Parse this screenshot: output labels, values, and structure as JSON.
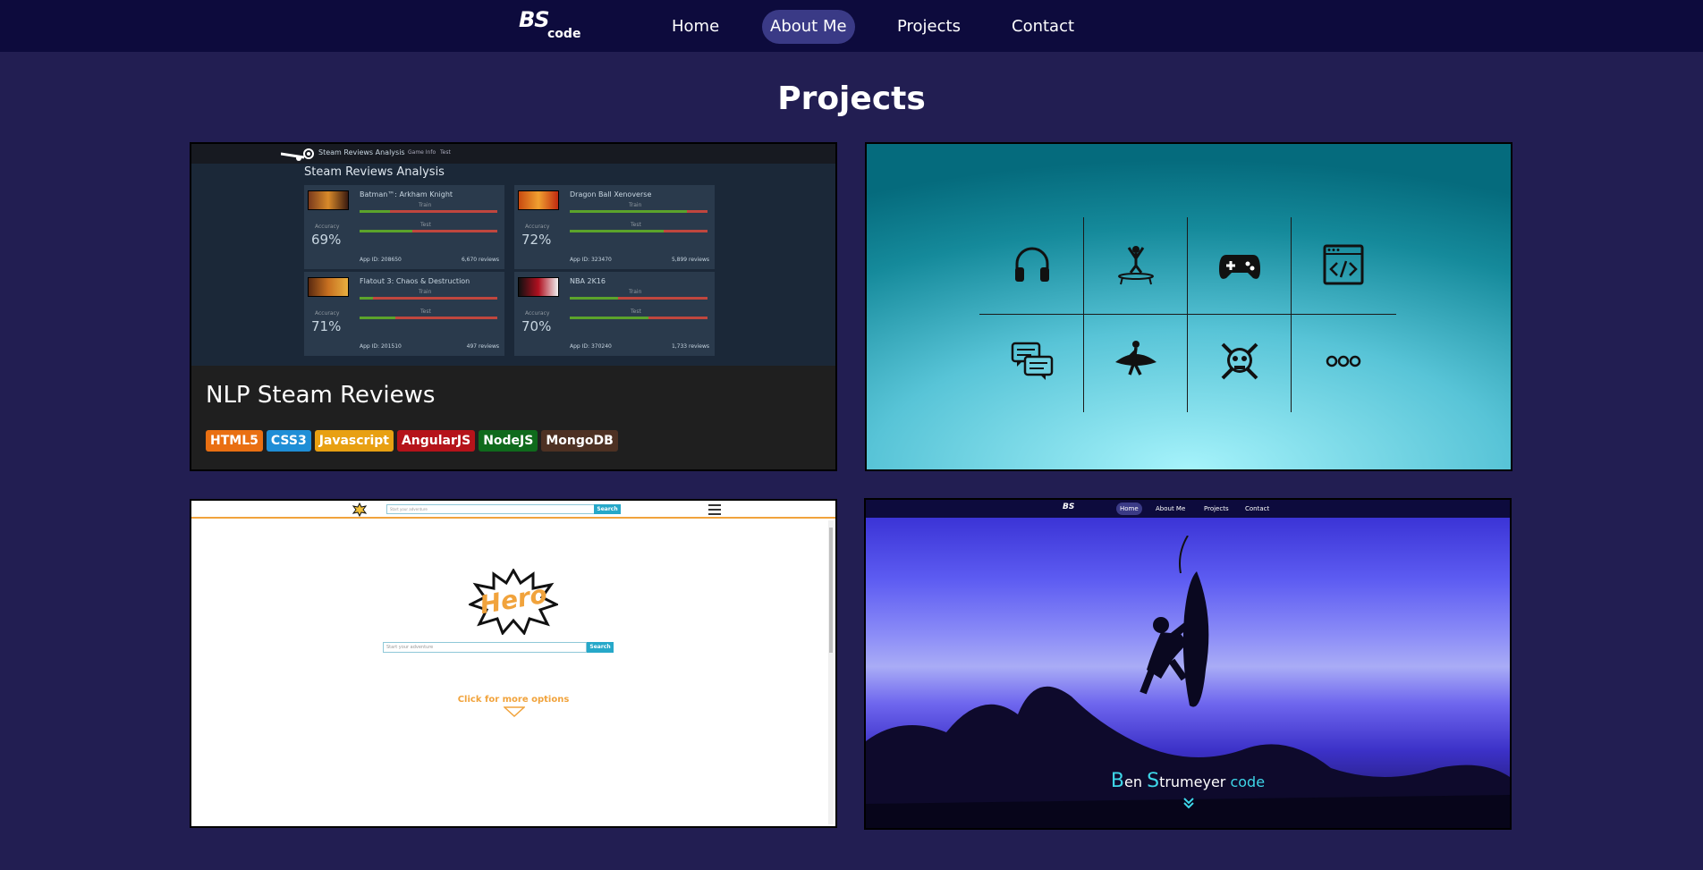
{
  "nav": {
    "logo_top": "BS",
    "logo_bottom": "code",
    "links": [
      {
        "label": "Home"
      },
      {
        "label": "About Me"
      },
      {
        "label": "Projects"
      },
      {
        "label": "Contact"
      }
    ],
    "active_link": "About Me"
  },
  "section": {
    "title": "Projects"
  },
  "colors": {
    "page_background": "#221e52",
    "navbar": "#0d0b3d",
    "nav_active": "#3a3a86"
  },
  "projects": [
    {
      "name": "NLP Steam Reviews",
      "badges": [
        {
          "label": "HTML5",
          "color": "#e96f12"
        },
        {
          "label": "CSS3",
          "color": "#1f8ed6"
        },
        {
          "label": "Javascript",
          "color": "#e8a012"
        },
        {
          "label": "AngularJS",
          "color": "#b5131a"
        },
        {
          "label": "NodeJS",
          "color": "#0f6a1c"
        },
        {
          "label": "MongoDB",
          "color": "#4d3123"
        }
      ],
      "preview": {
        "app_title": "Steam Reviews Analysis",
        "tabs": [
          "Game Info",
          "Test"
        ],
        "heading": "Steam Reviews Analysis",
        "games": [
          {
            "name": "Batman™: Arkham Knight",
            "accuracy": "69%",
            "app_id": "App ID: 208650",
            "reviews": "6,670 reviews"
          },
          {
            "name": "Dragon Ball Xenoverse",
            "accuracy": "72%",
            "app_id": "App ID: 323470",
            "reviews": "5,899 reviews"
          },
          {
            "name": "Flatout 3: Chaos & Destruction",
            "accuracy": "71%",
            "app_id": "App ID: 201510",
            "reviews": "497 reviews"
          },
          {
            "name": "NBA 2K16",
            "accuracy": "70%",
            "app_id": "App ID: 370240",
            "reviews": "1,733 reviews"
          }
        ],
        "accuracy_label": "Accuracy",
        "train_label": "Train",
        "test_label": "Test"
      }
    },
    {
      "icons": [
        "headphones-icon",
        "trampoline-icon",
        "gamepad-icon",
        "code-window-icon",
        "chat-icon",
        "surfer-icon",
        "skull-icon",
        "more-icon"
      ]
    },
    {
      "preview": {
        "search_placeholder": "Start your adventure",
        "search_button": "Search",
        "hero_logo": "Hero",
        "more_options": "Click for more options"
      }
    },
    {
      "preview": {
        "nav_links": [
          "Home",
          "About Me",
          "Projects",
          "Contact"
        ],
        "title_B": "B",
        "title_en": "en ",
        "title_S": "S",
        "title_rest": "trumeyer ",
        "title_code": "code"
      }
    }
  ]
}
